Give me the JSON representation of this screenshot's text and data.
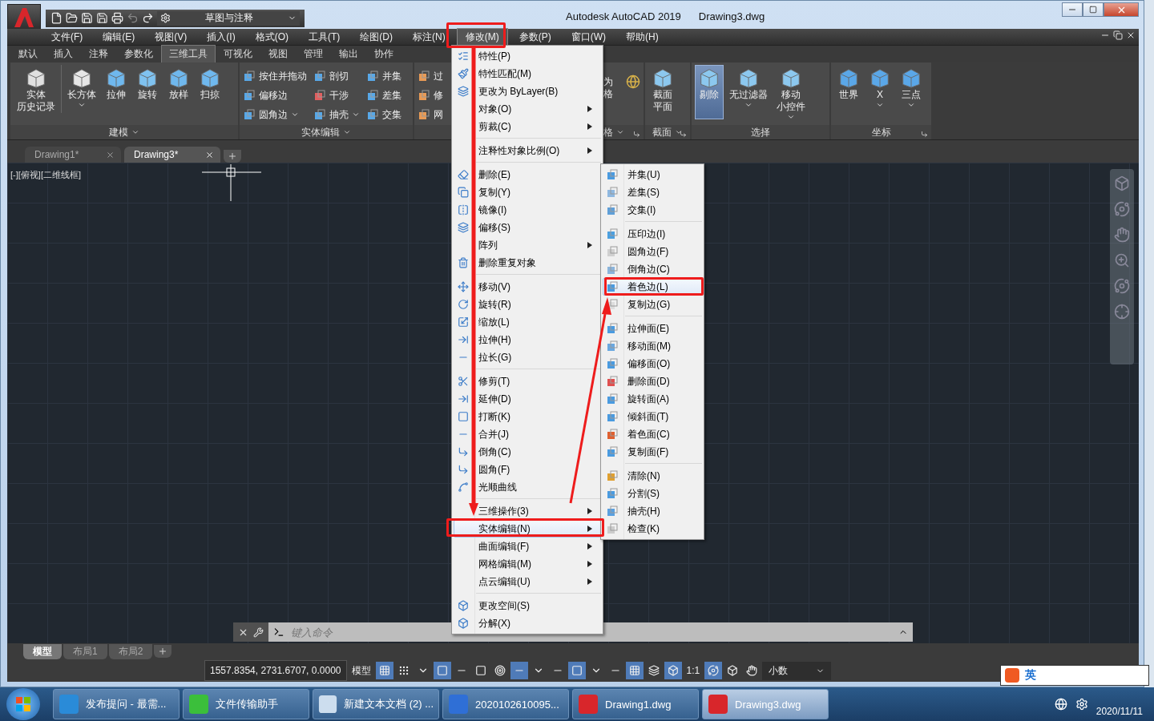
{
  "title_bar": {
    "workspace": "草图与注释",
    "app_title": "Autodesk AutoCAD 2019",
    "file_name": "Drawing3.dwg"
  },
  "menu_bar": [
    {
      "label": "文件(F)",
      "selected": false
    },
    {
      "label": "编辑(E)",
      "selected": false
    },
    {
      "label": "视图(V)",
      "selected": false
    },
    {
      "label": "插入(I)",
      "selected": false
    },
    {
      "label": "格式(O)",
      "selected": false
    },
    {
      "label": "工具(T)",
      "selected": false
    },
    {
      "label": "绘图(D)",
      "selected": false
    },
    {
      "label": "标注(N)",
      "selected": false
    },
    {
      "label": "修改(M)",
      "selected": true
    },
    {
      "label": "参数(P)",
      "selected": false
    },
    {
      "label": "窗口(W)",
      "selected": false
    },
    {
      "label": "帮助(H)",
      "selected": false
    }
  ],
  "ribbon_tabs": [
    {
      "label": "默认",
      "selected": false
    },
    {
      "label": "插入",
      "selected": false
    },
    {
      "label": "注释",
      "selected": false
    },
    {
      "label": "参数化",
      "selected": false
    },
    {
      "label": "三维工具",
      "selected": true
    },
    {
      "label": "可视化",
      "selected": false
    },
    {
      "label": "视图",
      "selected": false
    },
    {
      "label": "管理",
      "selected": false
    },
    {
      "label": "输出",
      "selected": false
    },
    {
      "label": "协作",
      "selected": false
    }
  ],
  "ribbon_panels": [
    {
      "kind": "large",
      "title": "建模",
      "title_menu": true,
      "launcher": false,
      "buttons": [
        {
          "lines": [
            "实体",
            "历史记录"
          ],
          "dropdown": false,
          "selected": false
        },
        {
          "lines": [
            "长方体"
          ],
          "dropdown": true,
          "selected": false
        },
        {
          "lines": [
            "拉伸"
          ],
          "dropdown": false,
          "selected": false
        },
        {
          "lines": [
            "旋转"
          ],
          "dropdown": false,
          "selected": false
        },
        {
          "lines": [
            "放样"
          ],
          "dropdown": false,
          "selected": false
        },
        {
          "lines": [
            "扫掠"
          ],
          "dropdown": false,
          "selected": false
        }
      ]
    },
    {
      "kind": "small",
      "title": "实体编辑",
      "title_menu": true,
      "launcher": false,
      "buttons": [
        {
          "label": "按住并拖动",
          "dropdown": false
        },
        {
          "label": "偏移边",
          "dropdown": false
        },
        {
          "label": "圆角边",
          "dropdown": true
        },
        {
          "label": "剖切",
          "dropdown": false
        },
        {
          "label": "干涉",
          "dropdown": false
        },
        {
          "label": "抽壳",
          "dropdown": true
        },
        {
          "label": "并集",
          "dropdown": false
        },
        {
          "label": "差集",
          "dropdown": false
        },
        {
          "label": "交集",
          "dropdown": false
        }
      ]
    },
    {
      "kind": "partial",
      "title": "格",
      "title_menu": true,
      "launcher": true,
      "buttons": [
        {
          "lines": [
            "过"
          ]
        },
        {
          "lines": [
            "修"
          ]
        },
        {
          "lines": [
            "网"
          ]
        },
        {
          "lines": [
            "为",
            "格"
          ]
        }
      ]
    },
    {
      "kind": "large",
      "title": "截面",
      "title_menu": true,
      "launcher": true,
      "buttons": [
        {
          "lines": [
            "截面",
            "平面"
          ],
          "dropdown": false,
          "selected": false
        }
      ]
    },
    {
      "kind": "large",
      "title": "选择",
      "title_menu": false,
      "launcher": false,
      "buttons": [
        {
          "lines": [
            "剔除"
          ],
          "dropdown": false,
          "selected": true
        },
        {
          "lines": [
            "无过滤器"
          ],
          "dropdown": true,
          "selected": false
        },
        {
          "lines": [
            "移动",
            "小控件"
          ],
          "dropdown": true,
          "selected": false
        }
      ]
    },
    {
      "kind": "large",
      "title": "坐标",
      "title_menu": false,
      "launcher": true,
      "buttons": [
        {
          "lines": [
            "世界"
          ],
          "dropdown": false,
          "selected": false
        },
        {
          "lines": [
            "X"
          ],
          "dropdown": true,
          "selected": false
        },
        {
          "lines": [
            "三点"
          ],
          "dropdown": true,
          "selected": false
        }
      ]
    }
  ],
  "doc_tabs": [
    {
      "label": "Drawing1*",
      "selected": false
    },
    {
      "label": "Drawing3*",
      "selected": true
    }
  ],
  "viewport_label": "[-][俯视][二维线框]",
  "modify_menu": [
    [
      {
        "label": "特性(P)",
        "submenu": false,
        "selected": false
      },
      {
        "label": "特性匹配(M)",
        "submenu": false,
        "selected": false
      },
      {
        "label": "更改为 ByLayer(B)",
        "submenu": false,
        "selected": false
      },
      {
        "label": "对象(O)",
        "submenu": true,
        "selected": false
      },
      {
        "label": "剪裁(C)",
        "submenu": true,
        "selected": false
      }
    ],
    [
      {
        "label": "注释性对象比例(O)",
        "submenu": true,
        "selected": false
      }
    ],
    [
      {
        "label": "删除(E)",
        "submenu": false,
        "selected": false
      },
      {
        "label": "复制(Y)",
        "submenu": false,
        "selected": false
      },
      {
        "label": "镜像(I)",
        "submenu": false,
        "selected": false
      },
      {
        "label": "偏移(S)",
        "submenu": false,
        "selected": false
      },
      {
        "label": "阵列",
        "submenu": true,
        "selected": false
      },
      {
        "label": "删除重复对象",
        "submenu": false,
        "selected": false
      }
    ],
    [
      {
        "label": "移动(V)",
        "submenu": false,
        "selected": false
      },
      {
        "label": "旋转(R)",
        "submenu": false,
        "selected": false
      },
      {
        "label": "缩放(L)",
        "submenu": false,
        "selected": false
      },
      {
        "label": "拉伸(H)",
        "submenu": false,
        "selected": false
      },
      {
        "label": "拉长(G)",
        "submenu": false,
        "selected": false
      }
    ],
    [
      {
        "label": "修剪(T)",
        "submenu": false,
        "selected": false
      },
      {
        "label": "延伸(D)",
        "submenu": false,
        "selected": false
      },
      {
        "label": "打断(K)",
        "submenu": false,
        "selected": false
      },
      {
        "label": "合并(J)",
        "submenu": false,
        "selected": false
      },
      {
        "label": "倒角(C)",
        "submenu": false,
        "selected": false
      },
      {
        "label": "圆角(F)",
        "submenu": false,
        "selected": false
      },
      {
        "label": "光顺曲线",
        "submenu": false,
        "selected": false
      }
    ],
    [
      {
        "label": "三维操作(3)",
        "submenu": true,
        "selected": false
      },
      {
        "label": "实体编辑(N)",
        "submenu": true,
        "selected": true
      },
      {
        "label": "曲面编辑(F)",
        "submenu": true,
        "selected": false
      },
      {
        "label": "网格编辑(M)",
        "submenu": true,
        "selected": false
      },
      {
        "label": "点云编辑(U)",
        "submenu": true,
        "selected": false
      }
    ],
    [
      {
        "label": "更改空间(S)",
        "submenu": false,
        "selected": false
      },
      {
        "label": "分解(X)",
        "submenu": false,
        "selected": false
      }
    ]
  ],
  "solid_edit_submenu": [
    [
      {
        "label": "并集(U)",
        "selected": false
      },
      {
        "label": "差集(S)",
        "selected": false
      },
      {
        "label": "交集(I)",
        "selected": false
      }
    ],
    [
      {
        "label": "压印边(I)",
        "selected": false
      },
      {
        "label": "圆角边(F)",
        "selected": false
      },
      {
        "label": "倒角边(C)",
        "selected": false
      },
      {
        "label": "着色边(L)",
        "selected": true
      },
      {
        "label": "复制边(G)",
        "selected": false
      }
    ],
    [
      {
        "label": "拉伸面(E)",
        "selected": false
      },
      {
        "label": "移动面(M)",
        "selected": false
      },
      {
        "label": "偏移面(O)",
        "selected": false
      },
      {
        "label": "删除面(D)",
        "selected": false
      },
      {
        "label": "旋转面(A)",
        "selected": false
      },
      {
        "label": "倾斜面(T)",
        "selected": false
      },
      {
        "label": "着色面(C)",
        "selected": false
      },
      {
        "label": "复制面(F)",
        "selected": false
      }
    ],
    [
      {
        "label": "清除(N)",
        "selected": false
      },
      {
        "label": "分割(S)",
        "selected": false
      },
      {
        "label": "抽壳(H)",
        "selected": false
      },
      {
        "label": "检查(K)",
        "selected": false
      }
    ]
  ],
  "command_line": {
    "placeholder": "键入命令"
  },
  "layout_tabs": [
    {
      "label": "模型",
      "selected": true
    },
    {
      "label": "布局1",
      "selected": false
    },
    {
      "label": "布局2",
      "selected": false
    }
  ],
  "status_bar": {
    "coordinates": "1557.8354, 2731.6707, 0.0000",
    "space": "模型",
    "scale": "1:1",
    "units": "小数",
    "toggles": [
      {
        "on": true
      },
      {
        "on": false
      },
      {
        "on": false
      },
      {
        "on": true
      },
      {
        "on": false
      },
      {
        "on": false
      },
      {
        "on": false
      },
      {
        "on": true
      },
      {
        "on": false
      },
      {
        "on": false
      },
      {
        "on": true
      },
      {
        "on": false
      },
      {
        "on": false
      },
      {
        "on": true
      },
      {
        "on": false
      },
      {
        "on": true
      },
      {
        "on": true
      },
      {
        "on": false
      },
      {
        "on": false
      }
    ]
  },
  "taskbar": {
    "items": [
      {
        "label": "发布提问 - 最需...",
        "selected": false
      },
      {
        "label": "文件传输助手",
        "selected": false
      },
      {
        "label": "新建文本文档 (2) ...",
        "selected": false
      },
      {
        "label": "2020102610095...",
        "selected": false
      },
      {
        "label": "Drawing1.dwg",
        "selected": false
      },
      {
        "label": "Drawing3.dwg",
        "selected": true
      }
    ],
    "ime": "英",
    "date": "2020/11/11"
  }
}
